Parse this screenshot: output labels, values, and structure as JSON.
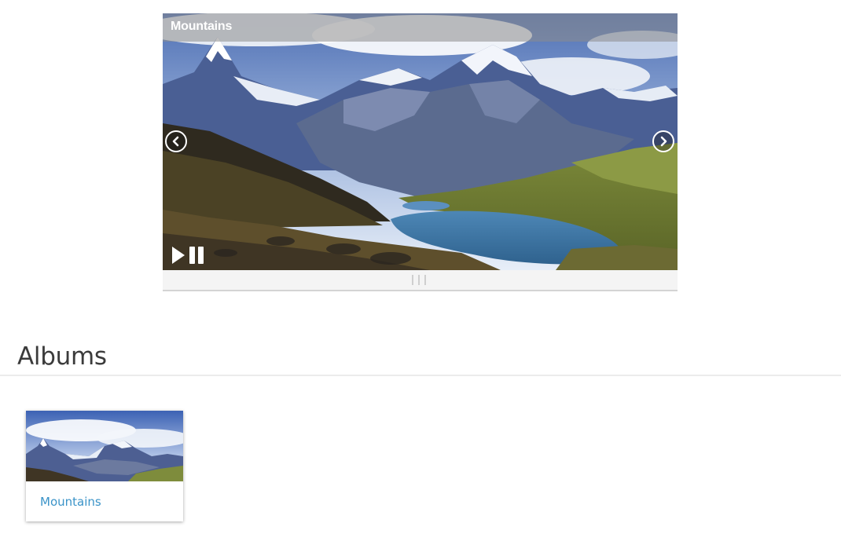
{
  "slideshow": {
    "caption": "Mountains",
    "image_subject": "alpine mountain lake landscape",
    "controls": {
      "prev_icon": "chevron-left-icon",
      "next_icon": "chevron-right-icon",
      "play_icon": "play-icon",
      "pause_icon": "pause-icon",
      "handle_icon": "drag-handle-icon"
    }
  },
  "albums": {
    "heading": "Albums",
    "items": [
      {
        "title": "Mountains"
      }
    ]
  },
  "colors": {
    "link": "#3a93c8",
    "heading": "#3b3b3b",
    "caption_text": "#ffffff",
    "footer_bg": "#f4f4f4"
  }
}
